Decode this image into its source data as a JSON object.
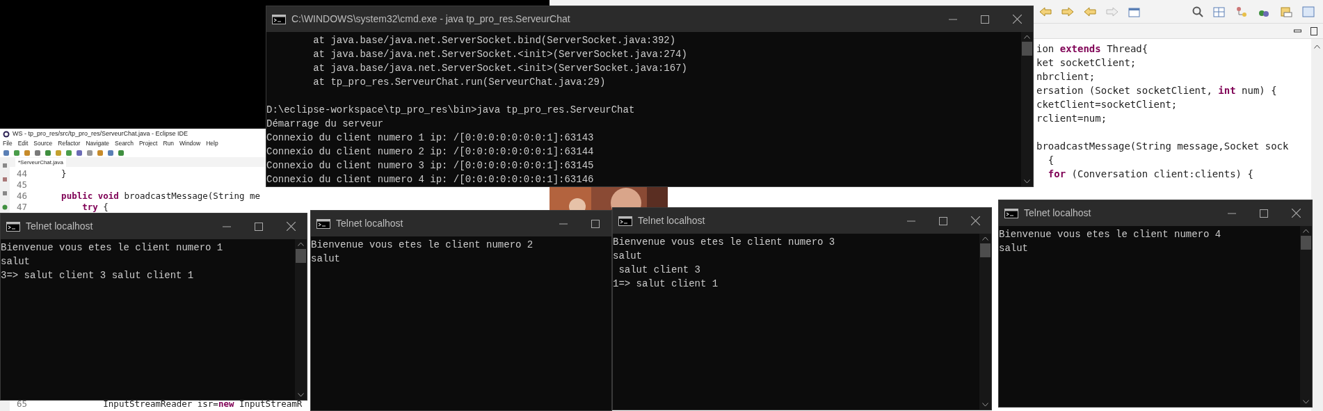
{
  "ide_back": {
    "code_blocks": [
      [
        "ion **extends** Thread{",
        "ket socketClient;",
        "nbrclient;",
        "ersation (Socket socketClient, **int** num) {",
        "cketClient=socketClient;",
        "rclient=num;"
      ],
      [
        "broadcastMessage(String message,Socket sock",
        "  {",
        "  **for** (Conversation client:clients) {"
      ]
    ]
  },
  "ide_front": {
    "title": "WS - tp_pro_res/src/tp_pro_res/ServeurChat.java - Eclipse IDE",
    "menu": [
      "File",
      "Edit",
      "Source",
      "Refactor",
      "Navigate",
      "Search",
      "Project",
      "Run",
      "Window",
      "Help"
    ],
    "tab": "*ServeurChat.java",
    "lines": [
      {
        "number": "44",
        "code": "    }"
      },
      {
        "number": "45"
      },
      {
        "number": "46",
        "code": "    **public** **void** broadcastMessage(String me"
      },
      {
        "number": "47",
        "code": "        **try** {"
      }
    ],
    "bottom_line": {
      "number": "65",
      "code": "            InputStreamReader isr=**new** InputStreamR"
    }
  },
  "cmd": {
    "title": "C:\\WINDOWS\\system32\\cmd.exe - java  tp_pro_res.ServeurChat",
    "blocks": [
      [
        "        at java.base/java.net.ServerSocket.bind(ServerSocket.java:392)",
        "        at java.base/java.net.ServerSocket.<init>(ServerSocket.java:274)",
        "        at java.base/java.net.ServerSocket.<init>(ServerSocket.java:167)",
        "        at tp_pro_res.ServeurChat.run(ServeurChat.java:29)"
      ],
      [
        "D:\\eclipse-workspace\\tp_pro_res\\bin>java tp_pro_res.ServeurChat",
        "Démarrage du serveur",
        "Connexio du client numero 1 ip: /[0:0:0:0:0:0:0:1]:63143",
        "Connexio du client numero 2 ip: /[0:0:0:0:0:0:0:1]:63144",
        "Connexio du client numero 3 ip: /[0:0:0:0:0:0:0:1]:63145",
        "Connexio du client numero 4 ip: /[0:0:0:0:0:0:0:1]:63146"
      ]
    ]
  },
  "telnets": [
    {
      "title": "Telnet localhost",
      "blocks": [
        [
          "Bienvenue vous etes le client numero 1",
          "salut",
          "3=> salut client 3 salut client 1"
        ]
      ]
    },
    {
      "title": "Telnet localhost",
      "blocks": [
        [
          "Bienvenue vous etes le client numero 2",
          "salut"
        ]
      ]
    },
    {
      "title": "Telnet localhost",
      "blocks": [
        [
          "Bienvenue vous etes le client numero 3",
          "salut",
          " salut client 3",
          "1=> salut client 1"
        ]
      ]
    },
    {
      "title": "Telnet localhost",
      "blocks": [
        [
          "Bienvenue vous etes le client numero 4",
          "salut"
        ]
      ]
    }
  ]
}
